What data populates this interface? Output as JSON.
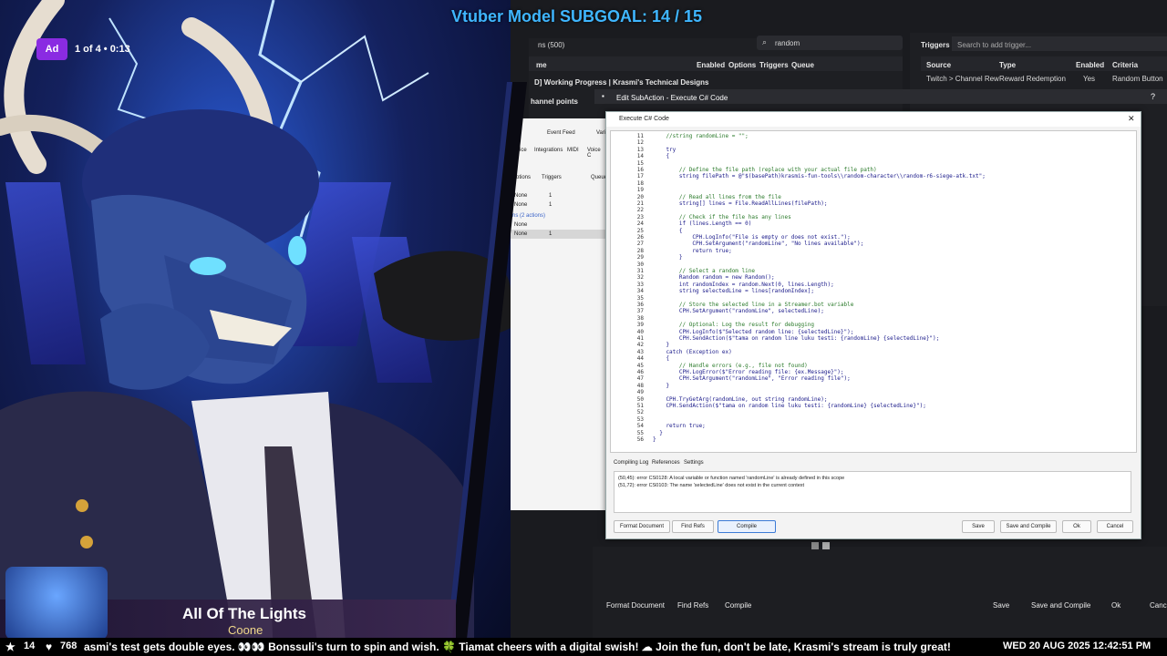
{
  "overlay": {
    "subgoal_title": "Vtuber Model SUBGOAL: 14 / 15",
    "ad_badge": "Ad",
    "ad_counter": "1 of 4 • 0:13",
    "song_title": "All Of The Lights",
    "song_artist": "Coone",
    "stars_count": "14",
    "hearts_count": "768",
    "ticker_text": "asmi's test gets double eyes. 👀👀 Bonssuli's turn to spin and wish. 🍀 Tiamat cheers with a digital swish! ☁ Join the fun, don't be late, Krasmi's stream is truly great!",
    "datetime": "WED 20 AUG 2025 12:42:51 PM"
  },
  "streamerbot": {
    "actions_header": "ns (500)",
    "search_value": "random",
    "columns": [
      "me",
      "Enabled",
      "Options",
      "Triggers",
      "Queue"
    ],
    "row1": "D] Working Progress | Krasmi's Technical Designs",
    "row2": "hannel points",
    "triggers_title": "Triggers",
    "triggers_search_placeholder": "Search to add trigger...",
    "trigger_columns": [
      "Source",
      "Type",
      "Enabled",
      "Criteria"
    ],
    "trigger_row": [
      "Twitch > Channel Rew",
      "Reward Redemption",
      "Yes",
      "Random Button"
    ],
    "edit_subaction_title": "Edit SubAction - Execute C# Code",
    "side_tabs": [
      "Event Feed",
      "Vari"
    ],
    "side_tabs2": [
      "rice",
      "Integrations",
      "MIDI",
      "Voice C"
    ],
    "sub_cols": [
      "otions",
      "Triggers",
      "Queue"
    ],
    "sub_rows": [
      [
        "None",
        "1"
      ],
      [
        "None",
        "1"
      ],
      [
        "ns (2 actions)",
        ""
      ],
      [
        "None",
        ""
      ],
      [
        "None",
        "1"
      ]
    ]
  },
  "dialog": {
    "title": "Execute C# Code",
    "code_lines": [
      {
        "n": "11",
        "t": "    //string randomLine = \"\";",
        "c": true
      },
      {
        "n": "12",
        "t": "",
        "c": false
      },
      {
        "n": "13",
        "t": "    try",
        "c": false
      },
      {
        "n": "14",
        "t": "    {",
        "c": false
      },
      {
        "n": "15",
        "t": "",
        "c": false
      },
      {
        "n": "16",
        "t": "        // Define the file path (replace with your actual file path)",
        "c": true
      },
      {
        "n": "17",
        "t": "        string filePath = @\"$(basePath)krasmis-fun-tools\\\\random-character\\\\random-r6-siege-atk.txt\";",
        "c": false
      },
      {
        "n": "18",
        "t": "",
        "c": false
      },
      {
        "n": "19",
        "t": "",
        "c": false
      },
      {
        "n": "20",
        "t": "        // Read all lines from the file",
        "c": true
      },
      {
        "n": "21",
        "t": "        string[] lines = File.ReadAllLines(filePath);",
        "c": false
      },
      {
        "n": "22",
        "t": "",
        "c": false
      },
      {
        "n": "23",
        "t": "        // Check if the file has any lines",
        "c": true
      },
      {
        "n": "24",
        "t": "        if (lines.Length == 0)",
        "c": false
      },
      {
        "n": "25",
        "t": "        {",
        "c": false
      },
      {
        "n": "26",
        "t": "            CPH.LogInfo(\"File is empty or does not exist.\");",
        "c": false
      },
      {
        "n": "27",
        "t": "            CPH.SetArgument(\"randomLine\", \"No lines available\");",
        "c": false
      },
      {
        "n": "28",
        "t": "            return true;",
        "c": false
      },
      {
        "n": "29",
        "t": "        }",
        "c": false
      },
      {
        "n": "30",
        "t": "",
        "c": false
      },
      {
        "n": "31",
        "t": "        // Select a random line",
        "c": true
      },
      {
        "n": "32",
        "t": "        Random random = new Random();",
        "c": false
      },
      {
        "n": "33",
        "t": "        int randomIndex = random.Next(0, lines.Length);",
        "c": false
      },
      {
        "n": "34",
        "t": "        string selectedLine = lines[randomIndex];",
        "c": false
      },
      {
        "n": "35",
        "t": "",
        "c": false
      },
      {
        "n": "36",
        "t": "        // Store the selected line in a Streamer.bot variable",
        "c": true
      },
      {
        "n": "37",
        "t": "        CPH.SetArgument(\"randomLine\", selectedLine);",
        "c": false
      },
      {
        "n": "38",
        "t": "",
        "c": false
      },
      {
        "n": "39",
        "t": "        // Optional: Log the result for debugging",
        "c": true
      },
      {
        "n": "40",
        "t": "        CPH.LogInfo($\"Selected random line: {selectedLine}\");",
        "c": false
      },
      {
        "n": "41",
        "t": "        CPH.SendAction($\"tama on random line luku testi: {randomLine} {selectedLine}\");",
        "c": false
      },
      {
        "n": "42",
        "t": "    }",
        "c": false
      },
      {
        "n": "43",
        "t": "    catch (Exception ex)",
        "c": false
      },
      {
        "n": "44",
        "t": "    {",
        "c": false
      },
      {
        "n": "45",
        "t": "        // Handle errors (e.g., file not found)",
        "c": true
      },
      {
        "n": "46",
        "t": "        CPH.LogError($\"Error reading file: {ex.Message}\");",
        "c": false
      },
      {
        "n": "47",
        "t": "        CPH.SetArgument(\"randomLine\", \"Error reading file\");",
        "c": false
      },
      {
        "n": "48",
        "t": "    }",
        "c": false
      },
      {
        "n": "49",
        "t": "",
        "c": false
      },
      {
        "n": "50",
        "t": "    CPH.TryGetArg(randomLine, out string randomLine);",
        "c": false
      },
      {
        "n": "51",
        "t": "    CPH.SendAction($\"tama on random line luku testi: {randomLine} {selectedLine}\");",
        "c": false
      },
      {
        "n": "52",
        "t": "",
        "c": false
      },
      {
        "n": "53",
        "t": "",
        "c": false
      },
      {
        "n": "54",
        "t": "    return true;",
        "c": false
      },
      {
        "n": "55",
        "t": "  }",
        "c": false
      },
      {
        "n": "56",
        "t": "}",
        "c": false
      }
    ],
    "tabs": [
      "Compiling Log",
      "References",
      "Settings"
    ],
    "errors": [
      "(50,45): error CS0128: A local variable or function named 'randomLine' is already defined in this scope",
      "(51,72): error CS0103: The name 'selectedLine' does not exist in the current context"
    ],
    "buttons": {
      "format": "Format Document",
      "find_refs": "Find Refs",
      "compile": "Compile",
      "save": "Save",
      "save_compile": "Save and Compile",
      "ok": "Ok",
      "cancel": "Cancel"
    }
  },
  "bottom_bar": {
    "format": "Format Document",
    "find_refs": "Find Refs",
    "compile": "Compile",
    "save": "Save",
    "save_compile": "Save and Compile",
    "ok": "Ok",
    "cancel": "Cance"
  },
  "colors": {
    "subgoal": "#3fb6ff",
    "ad_badge": "#8a2be2",
    "ticker_bg": "#000000"
  }
}
